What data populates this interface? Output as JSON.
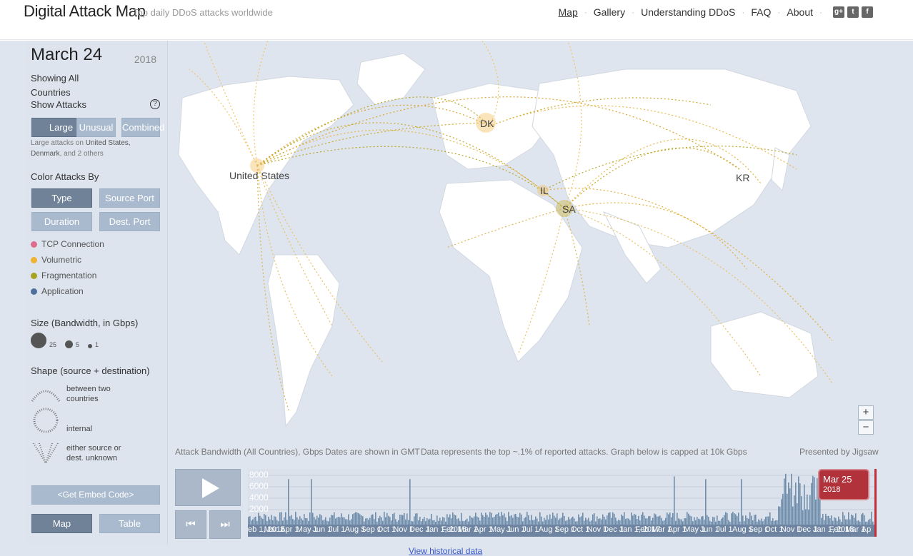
{
  "header": {
    "title": "Digital Attack Map",
    "tagline": "Top daily DDoS attacks worldwide",
    "nav": [
      "Map",
      "Gallery",
      "Understanding DDoS",
      "FAQ",
      "About"
    ],
    "socials": [
      "google-plus-icon",
      "twitter-icon",
      "facebook-icon"
    ]
  },
  "sidebar": {
    "date": "March 24",
    "year": "2018",
    "showing": "Showing All Countries",
    "show_attacks_label": "Show Attacks",
    "attack_filters": [
      "Large",
      "Unusual",
      "Combined"
    ],
    "attack_filter_selected": "Large",
    "note_prefix": "Large attacks on ",
    "note_countries": "United States,",
    "note_country2": "Denmark",
    "note_suffix": ", and 2 others",
    "color_by_label": "Color Attacks By",
    "color_by_options": [
      "Type",
      "Source Port",
      "Duration",
      "Dest. Port"
    ],
    "color_by_selected": "Type",
    "legend": [
      {
        "label": "TCP Connection",
        "color": "#de6f8c"
      },
      {
        "label": "Volumetric",
        "color": "#f0b331"
      },
      {
        "label": "Fragmentation",
        "color": "#a5a320"
      },
      {
        "label": "Application",
        "color": "#4d729c"
      }
    ],
    "size_label": "Size (Bandwidth, in Gbps)",
    "sizes": [
      "25",
      "5",
      "1"
    ],
    "shape_label": "Shape (source + destination)",
    "shapes": [
      "between two countries",
      "internal",
      "either source or dest. unknown"
    ],
    "embed_label": "<Get Embed Code>",
    "views": [
      "Map",
      "Table"
    ],
    "view_selected": "Map"
  },
  "map": {
    "labels": [
      "United States",
      "DK",
      "IL",
      "SA",
      "KR"
    ],
    "zoom_in": "+",
    "zoom_out": "−"
  },
  "bottom": {
    "bandwidth_label": "Attack Bandwidth (All Countries), Gbps",
    "dates_note": "Dates are shown in GMT",
    "data_note": "Data represents the top ~.1% of reported attacks. Graph below is capped at 10k Gbps",
    "presented_by": "Presented by Jigsaw",
    "y_ticks": [
      "8000",
      "6000",
      "4000",
      "2000"
    ],
    "x_ticks": [
      "eb 1, 2015",
      "Mar 1",
      "Apr 1",
      "May 1",
      "Jun 1",
      "Jul 1",
      "Aug 1",
      "Sep 1",
      "Oct 1",
      "Nov 1",
      "Dec 1",
      "Jan 1, 2016",
      "Feb 1",
      "Mar 1",
      "Apr 1",
      "May 1",
      "Jun 1",
      "Jul 1",
      "Aug 1",
      "Sep 1",
      "Oct 1",
      "Nov 1",
      "Dec 1",
      "Jan 1, 2017",
      "Feb 1",
      "Mar 1",
      "Apr 1",
      "May 1",
      "Jun 1",
      "Jul 1",
      "Aug 1",
      "Sep 1",
      "Oct 1",
      "Nov 1",
      "Dec 1",
      "Jan 1, 2018",
      "Feb 1",
      "Mar 1",
      "Ap"
    ],
    "marker_date": "Mar 25",
    "marker_year": "2018",
    "historical_link": "View historical data"
  }
}
